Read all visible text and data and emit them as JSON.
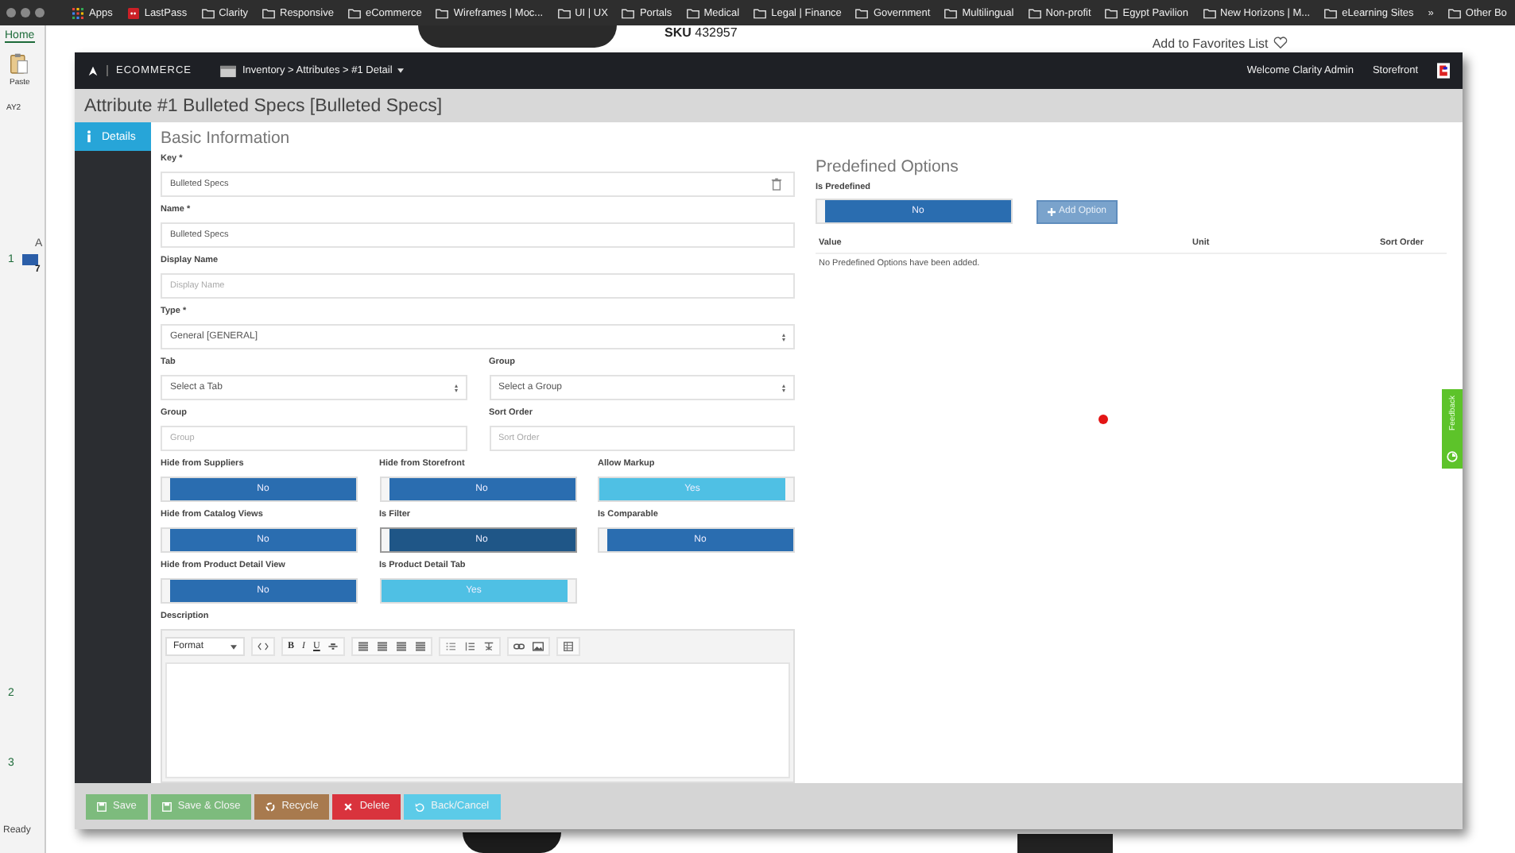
{
  "bookmarks_bar": {
    "items": [
      {
        "label": "Apps",
        "kind": "apps"
      },
      {
        "label": "LastPass",
        "kind": "app"
      },
      {
        "label": "Clarity",
        "kind": "folder"
      },
      {
        "label": "Responsive",
        "kind": "folder"
      },
      {
        "label": "eCommerce",
        "kind": "folder"
      },
      {
        "label": "Wireframes | Moc...",
        "kind": "folder"
      },
      {
        "label": "UI | UX",
        "kind": "folder"
      },
      {
        "label": "Portals",
        "kind": "folder"
      },
      {
        "label": "Medical",
        "kind": "folder"
      },
      {
        "label": "Legal | Finance",
        "kind": "folder"
      },
      {
        "label": "Government",
        "kind": "folder"
      },
      {
        "label": "Multilingual",
        "kind": "folder"
      },
      {
        "label": "Non-profit",
        "kind": "folder"
      },
      {
        "label": "Egypt Pavilion",
        "kind": "folder"
      },
      {
        "label": "New Horizons | M...",
        "kind": "folder"
      },
      {
        "label": "eLearning Sites",
        "kind": "folder"
      },
      {
        "label": "»",
        "kind": "more"
      },
      {
        "label": "Other Bo",
        "kind": "folder"
      }
    ]
  },
  "spreadsheet": {
    "ribbon_tab": "Home",
    "paste_label": "Paste",
    "cell_ref": "AY2",
    "column_header": "A",
    "row_numbers": [
      "1",
      "2",
      "3"
    ],
    "cell_value": "7",
    "status": "Ready"
  },
  "background_page": {
    "sku_label": "SKU",
    "sku": "432957",
    "favorites_link": "Add to Favorites List"
  },
  "app_bar": {
    "brand": "ECOMMERCE",
    "breadcrumb": "Inventory > Attributes > #1 Detail",
    "welcome": "Welcome Clarity Admin",
    "storefront_link": "Storefront"
  },
  "page_title": "Attribute #1 Bulleted Specs [Bulleted Specs]",
  "side_tabs": [
    {
      "label": "Details",
      "selected": true
    }
  ],
  "basic_info": {
    "heading": "Basic Information",
    "rows": [
      [
        {
          "label": "Key *",
          "kind": "text-delete",
          "value": "Bulleted Specs"
        }
      ],
      [
        {
          "label": "Name *",
          "kind": "text",
          "value": "Bulleted Specs"
        }
      ],
      [
        {
          "label": "Display Name",
          "kind": "text",
          "placeholder": "Display Name"
        }
      ],
      [
        {
          "label": "Type *",
          "kind": "select",
          "value": "General [GENERAL]"
        }
      ],
      [
        {
          "label": "Tab",
          "kind": "select",
          "value": "Select a Tab"
        },
        {
          "label": "Group",
          "kind": "select",
          "value": "Select a Group"
        }
      ],
      [
        {
          "label": "Group",
          "kind": "text",
          "placeholder": "Group"
        },
        {
          "label": "Sort Order",
          "kind": "text",
          "placeholder": "Sort Order"
        }
      ]
    ],
    "toggles": [
      {
        "label": "Hide from Suppliers",
        "value": "No",
        "on": false,
        "focused": false
      },
      {
        "label": "Hide from Storefront",
        "value": "No",
        "on": false,
        "focused": false
      },
      {
        "label": "Allow Markup",
        "value": "Yes",
        "on": true,
        "focused": false
      },
      {
        "label": "Hide from Catalog Views",
        "value": "No",
        "on": false,
        "focused": false
      },
      {
        "label": "Is Filter",
        "value": "No",
        "on": false,
        "focused": true
      },
      {
        "label": "Is Comparable",
        "value": "No",
        "on": false,
        "focused": false
      },
      {
        "label": "Hide from Product Detail View",
        "value": "No",
        "on": false,
        "focused": false
      },
      {
        "label": "Is Product Detail Tab",
        "value": "Yes",
        "on": true,
        "focused": false
      }
    ],
    "description": {
      "label": "Description",
      "format_label": "Format",
      "tool_groups": [
        [
          {
            "kind": "code"
          }
        ],
        [
          {
            "kind": "bold",
            "label": "B"
          },
          {
            "kind": "italic",
            "label": "I"
          },
          {
            "kind": "underline",
            "label": "U"
          },
          {
            "kind": "strike"
          }
        ],
        [
          {
            "kind": "align"
          },
          {
            "kind": "align"
          },
          {
            "kind": "align"
          },
          {
            "kind": "align"
          }
        ],
        [
          {
            "kind": "bullets"
          },
          {
            "kind": "numbers"
          },
          {
            "kind": "clear"
          }
        ],
        [
          {
            "kind": "link"
          },
          {
            "kind": "image"
          }
        ],
        [
          {
            "kind": "table"
          }
        ]
      ]
    }
  },
  "predefined": {
    "heading": "Predefined Options",
    "toggle": {
      "label": "Is Predefined",
      "value": "No",
      "on": false
    },
    "add_button": "Add Option",
    "columns": [
      "Value",
      "Unit",
      "Sort Order"
    ],
    "empty_message": "No Predefined Options have been added."
  },
  "footer_buttons": [
    {
      "label": "Save",
      "kind": "save"
    },
    {
      "label": "Save & Close",
      "kind": "save"
    },
    {
      "label": "Recycle",
      "kind": "recycle"
    },
    {
      "label": "Delete",
      "kind": "delete"
    },
    {
      "label": "Back/Cancel",
      "kind": "back"
    }
  ],
  "feedback_tab": {
    "label": "Feedback"
  }
}
